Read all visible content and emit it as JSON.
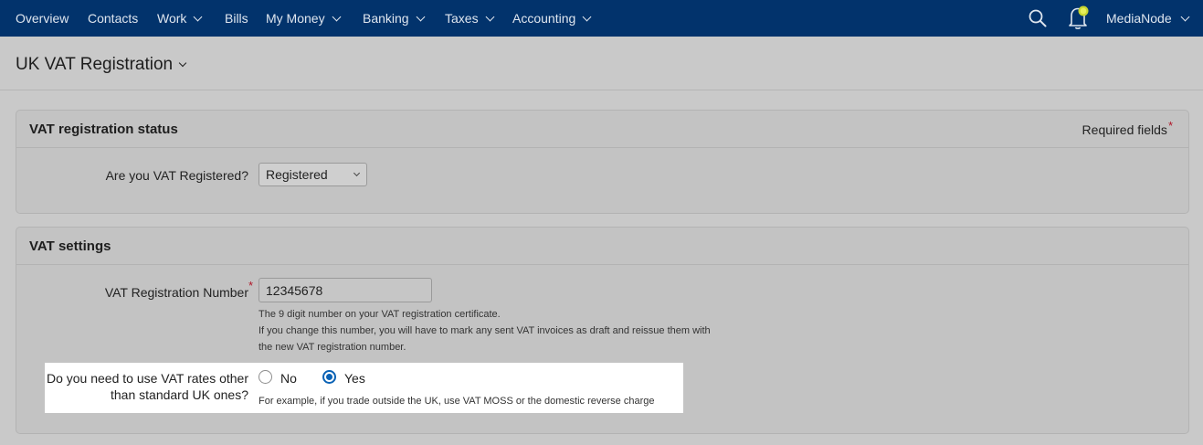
{
  "nav": {
    "items": [
      {
        "label": "Overview",
        "dropdown": false
      },
      {
        "label": "Contacts",
        "dropdown": false
      },
      {
        "label": "Work",
        "dropdown": true
      },
      {
        "label": "Bills",
        "dropdown": false
      },
      {
        "label": "My Money",
        "dropdown": true
      },
      {
        "label": "Banking",
        "dropdown": true
      },
      {
        "label": "Taxes",
        "dropdown": true
      },
      {
        "label": "Accounting",
        "dropdown": true
      }
    ],
    "account_label": "MediaNode",
    "icons": [
      "search-icon",
      "bell-icon",
      "chevron-down-icon"
    ],
    "bar_color": "#02336c"
  },
  "page": {
    "title": "UK VAT Registration"
  },
  "status_panel": {
    "title": "VAT registration status",
    "required_text": "Required fields",
    "required_marker": "*",
    "question": "Are you VAT Registered?",
    "select_value": "Registered"
  },
  "settings_panel": {
    "title": "VAT settings",
    "reg_number_label": "VAT Registration Number",
    "reg_number_marker": "*",
    "reg_number_value": "12345678",
    "reg_help_line1": "The 9 digit number on your VAT registration certificate.",
    "reg_help_line2": "If you change this number, you will have to mark any sent VAT invoices as draft and reissue them with",
    "reg_help_line3": "the new VAT registration number.",
    "rates_question_line1": "Do you need to use VAT rates other",
    "rates_question_line2": "than standard UK ones?",
    "option_no": "No",
    "option_yes": "Yes",
    "selected_option": "Yes",
    "rates_help": "For example, if you trade outside the UK, use VAT MOSS or the domestic reverse charge",
    "accent_color": "#0a62b5"
  }
}
